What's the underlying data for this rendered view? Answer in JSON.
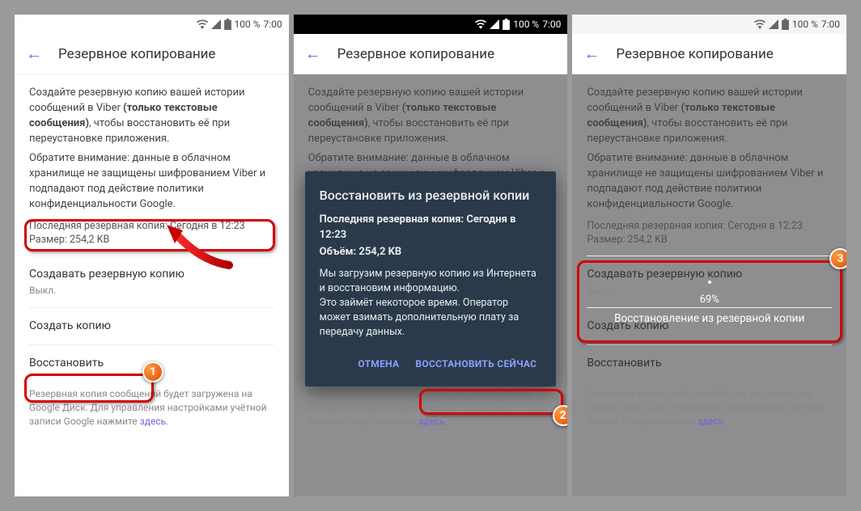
{
  "status": {
    "pct": "100 %",
    "time": "7:00"
  },
  "header": {
    "title": "Резервное копирование"
  },
  "desc": {
    "p1a": "Создайте резервную копию вашей истории сообщений в Viber ",
    "p1b": "(только текстовые сообщения)",
    "p1c": ", чтобы восстановить её при переустановке приложения.",
    "p2": "Обратите внимание: данные в облачном хранилище не защищены шифрованием Viber и подпадают под действие политики конфиденциальности Google."
  },
  "info": {
    "last": "Последняя резервная копия: Сегодня в 12:23",
    "size": "Размер: 254,2 KB"
  },
  "items": {
    "auto": {
      "label": "Создавать резервную копию",
      "sub": "Выкл."
    },
    "create": {
      "label": "Создать копию"
    },
    "restore": {
      "label": "Восстановить"
    }
  },
  "foot": {
    "text": "Резервная копия сообщений будет загружена на Google Диск. Для управления настройками учётной записи Google нажмите ",
    "link": "здесь",
    "dot": "."
  },
  "dialog": {
    "title": "Восстановить из резервной копии",
    "meta1": "Последняя резервная копия: Сегодня в 12:23",
    "meta2": "Объём: 254,2 KB",
    "body": "Мы загрузим резервную копию из Интернета и восстановим информацию.\nЭто займёт некоторое время. Оператор может взимать дополнительную плату за передачу данных.",
    "cancel": "ОТМЕНА",
    "ok": "ВОССТАНОВИТЬ СЕЙЧАС"
  },
  "progress": {
    "pct": "69%",
    "label": "Восстановление из резервной копии"
  },
  "badges": {
    "b1": "1",
    "b2": "2",
    "b3": "3"
  }
}
